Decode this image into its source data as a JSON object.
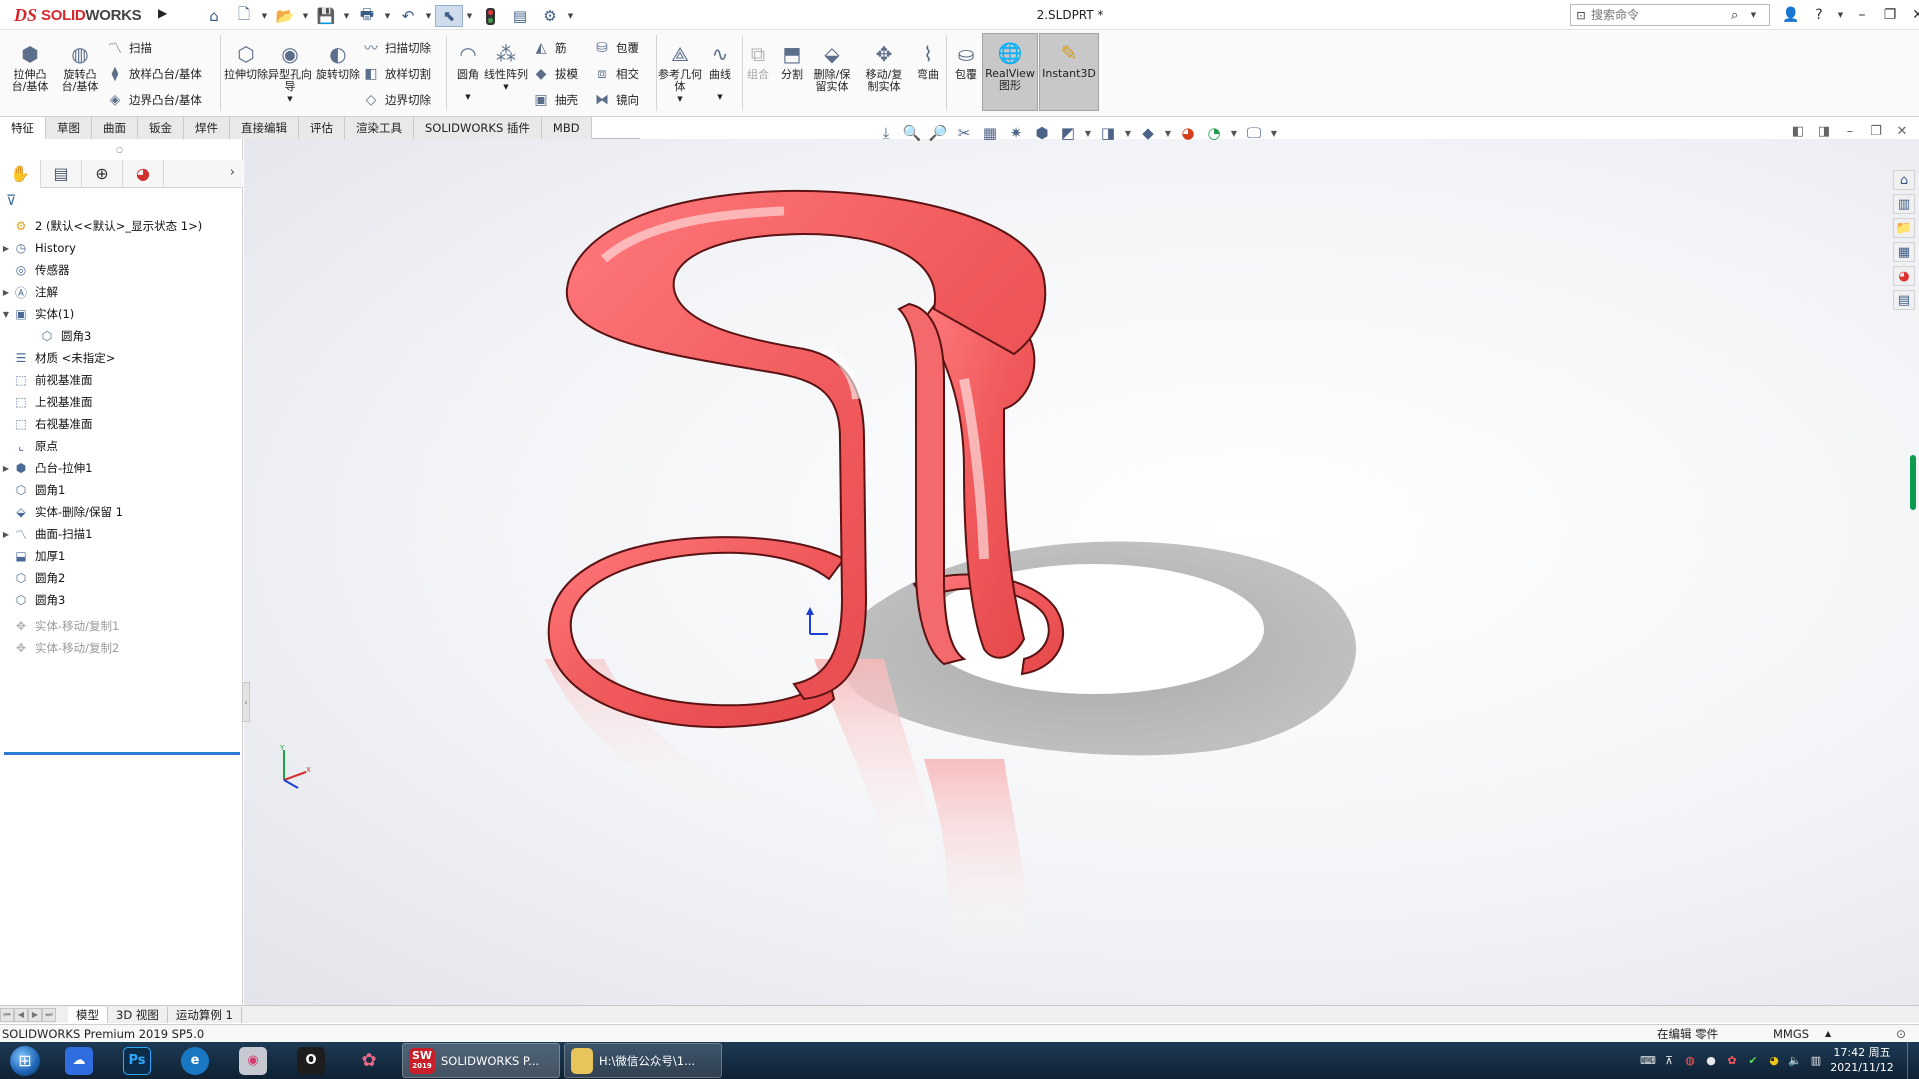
{
  "app": {
    "logo_prefix": "DS",
    "logo_text_a": "SOLID",
    "logo_text_b": "WORKS",
    "doc_title": "2.SLDPRT *",
    "search_placeholder": "搜索命令"
  },
  "ribbon": {
    "extrude_boss": "拉伸凸台/基体",
    "revolve_boss": "旋转凸台/基体",
    "sweep": "扫描",
    "loft_boss": "放样凸台/基体",
    "boundary_boss": "边界凸台/基体",
    "extrude_cut": "拉伸切除",
    "hole_wizard": "异型孔向导",
    "revolve_cut": "旋转切除",
    "swept_cut": "扫描切除",
    "loft_cut": "放样切割",
    "boundary_cut": "边界切除",
    "fillet": "圆角",
    "linear_pattern": "线性阵列",
    "rib": "筋",
    "draft": "拔模",
    "shell": "抽壳",
    "wrap": "包覆",
    "intersect": "相交",
    "mirror": "镜向",
    "ref_geometry": "参考几何体",
    "curves": "曲线",
    "combine": "组合",
    "split": "分割",
    "delete_keep_body": "删除/保留实体",
    "move_copy_body": "移动/复制实体",
    "flex": "弯曲",
    "wrap2": "包覆",
    "realview": "RealView图形",
    "instant3d": "Instant3D"
  },
  "tabs": [
    "特征",
    "草图",
    "曲面",
    "钣金",
    "焊件",
    "直接编辑",
    "评估",
    "渲染工具",
    "SOLIDWORKS 插件",
    "MBD"
  ],
  "tree": {
    "root": "2 (默认<<默认>_显示状态 1>)",
    "history": "History",
    "sensors": "传感器",
    "annotations": "注解",
    "solid_bodies": "实体(1)",
    "body_fillet3": "圆角3",
    "material": "材质 <未指定>",
    "front_plane": "前视基准面",
    "top_plane": "上视基准面",
    "right_plane": "右视基准面",
    "origin": "原点",
    "boss_extrude1": "凸台-拉伸1",
    "fillet1": "圆角1",
    "body_delete_keep1": "实体-删除/保留 1",
    "surface_sweep1": "曲面-扫描1",
    "thicken1": "加厚1",
    "fillet2": "圆角2",
    "fillet3": "圆角3",
    "body_move_copy1": "实体-移动/复制1",
    "body_move_copy2": "实体-移动/复制2"
  },
  "bottom_tabs": [
    "模型",
    "3D 视图",
    "运动算例 1"
  ],
  "status": {
    "product": "SOLIDWORKS Premium 2019 SP5.0",
    "mode": "在编辑 零件",
    "units": "MMGS"
  },
  "taskbar": {
    "sw_icon_label": "SW",
    "sw_icon_year": "2019",
    "task_solidworks": "SOLIDWORKS P...",
    "task_explorer": "H:\\微信公众号\\1...",
    "time": "17:42 周五",
    "date": "2021/11/12"
  },
  "colors": {
    "model_red": "#f0595b",
    "brand_red": "#d8262e",
    "rollback_blue": "#2b7ad3"
  }
}
